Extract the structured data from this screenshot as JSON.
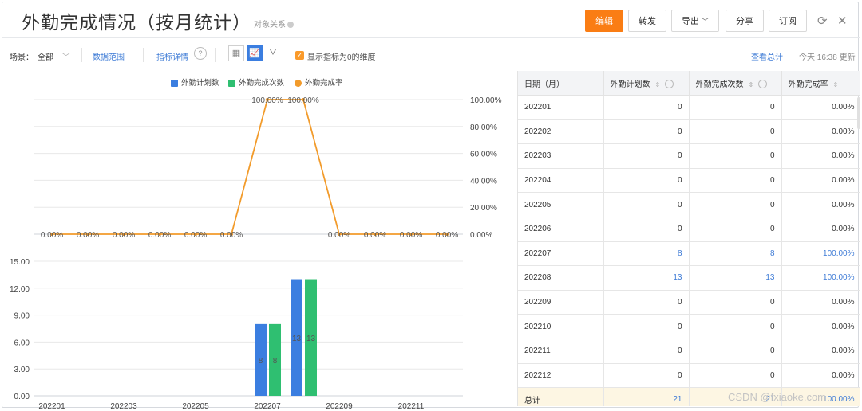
{
  "header": {
    "title": "外勤完成情况（按月统计）",
    "relation_label": "对象关系",
    "buttons": {
      "edit": "编辑",
      "forward": "转发",
      "export": "导出",
      "share": "分享",
      "subscribe": "订阅"
    },
    "icons": [
      "refresh-icon",
      "close-icon"
    ]
  },
  "toolbar": {
    "scene_label": "场景：",
    "scene_value": "全部",
    "data_range": "数据范围",
    "metric_details": "指标详情",
    "show_zero_label": "显示指标为0的维度",
    "view_total": "查看总计",
    "updated": "今天 16:38 更新"
  },
  "colors": {
    "plan": "#3b7ee0",
    "done": "#2fbf71",
    "rate": "#f29b2b",
    "accent": "#fa7d14"
  },
  "chart_data": [
    {
      "type": "line",
      "series": [
        {
          "name": "外勤完成率",
          "values": [
            "0.00%",
            "0.00%",
            "0.00%",
            "0.00%",
            "0.00%",
            "0.00%",
            "100.00%",
            "100.00%",
            "0.00%",
            "0.00%",
            "0.00%",
            "0.00%"
          ]
        }
      ],
      "values_numeric": [
        0,
        0,
        0,
        0,
        0,
        0,
        100,
        100,
        0,
        0,
        0,
        0
      ],
      "y_ticks": [
        "100.00%",
        "80.00%",
        "60.00%",
        "40.00%",
        "20.00%",
        "0.00%"
      ],
      "ylim": [
        0,
        100
      ]
    },
    {
      "type": "bar",
      "categories": [
        "202201",
        "202202",
        "202203",
        "202204",
        "202205",
        "202206",
        "202207",
        "202208",
        "202209",
        "202210",
        "202211",
        "202212"
      ],
      "x_tick_labels": [
        "202201",
        "202203",
        "202205",
        "202207",
        "202209",
        "202211"
      ],
      "series": [
        {
          "name": "外勤计划数",
          "values": [
            0,
            0,
            0,
            0,
            0,
            0,
            8,
            13,
            0,
            0,
            0,
            0
          ]
        },
        {
          "name": "外勤完成次数",
          "values": [
            0,
            0,
            0,
            0,
            0,
            0,
            8,
            13,
            0,
            0,
            0,
            0
          ]
        }
      ],
      "y_ticks": [
        "15.00",
        "12.00",
        "9.00",
        "6.00",
        "3.00",
        "0.00"
      ],
      "ylim": [
        0,
        15
      ]
    }
  ],
  "legend": [
    "外勤计划数",
    "外勤完成次数",
    "外勤完成率"
  ],
  "table": {
    "columns": [
      "日期（月）",
      "外勤计划数",
      "外勤完成次数",
      "外勤完成率"
    ],
    "rows": [
      [
        "202201",
        "0",
        "0",
        "0.00%"
      ],
      [
        "202202",
        "0",
        "0",
        "0.00%"
      ],
      [
        "202203",
        "0",
        "0",
        "0.00%"
      ],
      [
        "202204",
        "0",
        "0",
        "0.00%"
      ],
      [
        "202205",
        "0",
        "0",
        "0.00%"
      ],
      [
        "202206",
        "0",
        "0",
        "0.00%"
      ],
      [
        "202207",
        "8",
        "8",
        "100.00%"
      ],
      [
        "202208",
        "13",
        "13",
        "100.00%"
      ],
      [
        "202209",
        "0",
        "0",
        "0.00%"
      ],
      [
        "202210",
        "0",
        "0",
        "0.00%"
      ],
      [
        "202211",
        "0",
        "0",
        "0.00%"
      ],
      [
        "202212",
        "0",
        "0",
        "0.00%"
      ]
    ],
    "total": [
      "总计",
      "21",
      "21",
      "100.00%"
    ]
  },
  "watermark": "CSDN @fxiaoke.com"
}
